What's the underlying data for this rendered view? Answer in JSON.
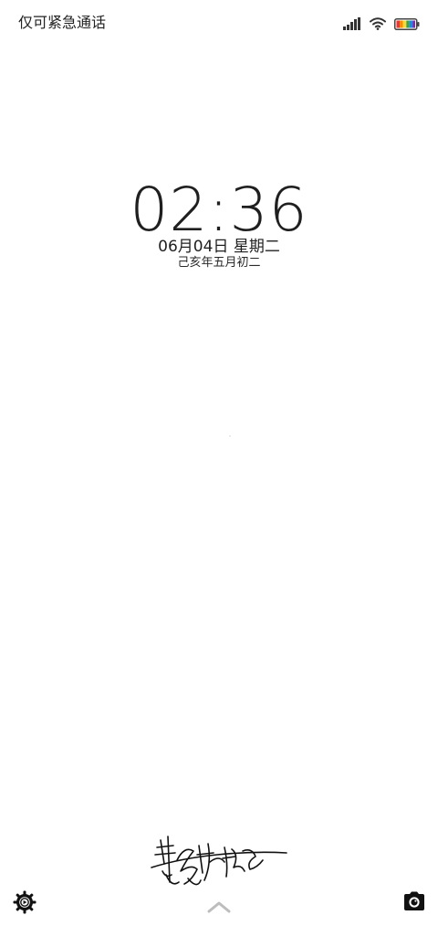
{
  "status_bar": {
    "carrier_text": "仅可紧急通话",
    "icons": [
      "signal-icon",
      "wifi-icon",
      "battery-icon"
    ]
  },
  "lock_screen": {
    "time": "02:36",
    "date": "06月04日 星期二",
    "lunar_date": "己亥年五月初二"
  },
  "bottom_bar": {
    "left_icon": "settings-gear-icon",
    "center_icon": "chevron-up-icon",
    "right_icon": "camera-icon"
  },
  "colors": {
    "text": "#1f1f1f",
    "background": "#ffffff",
    "icon_gray": "#bdbdbd"
  }
}
